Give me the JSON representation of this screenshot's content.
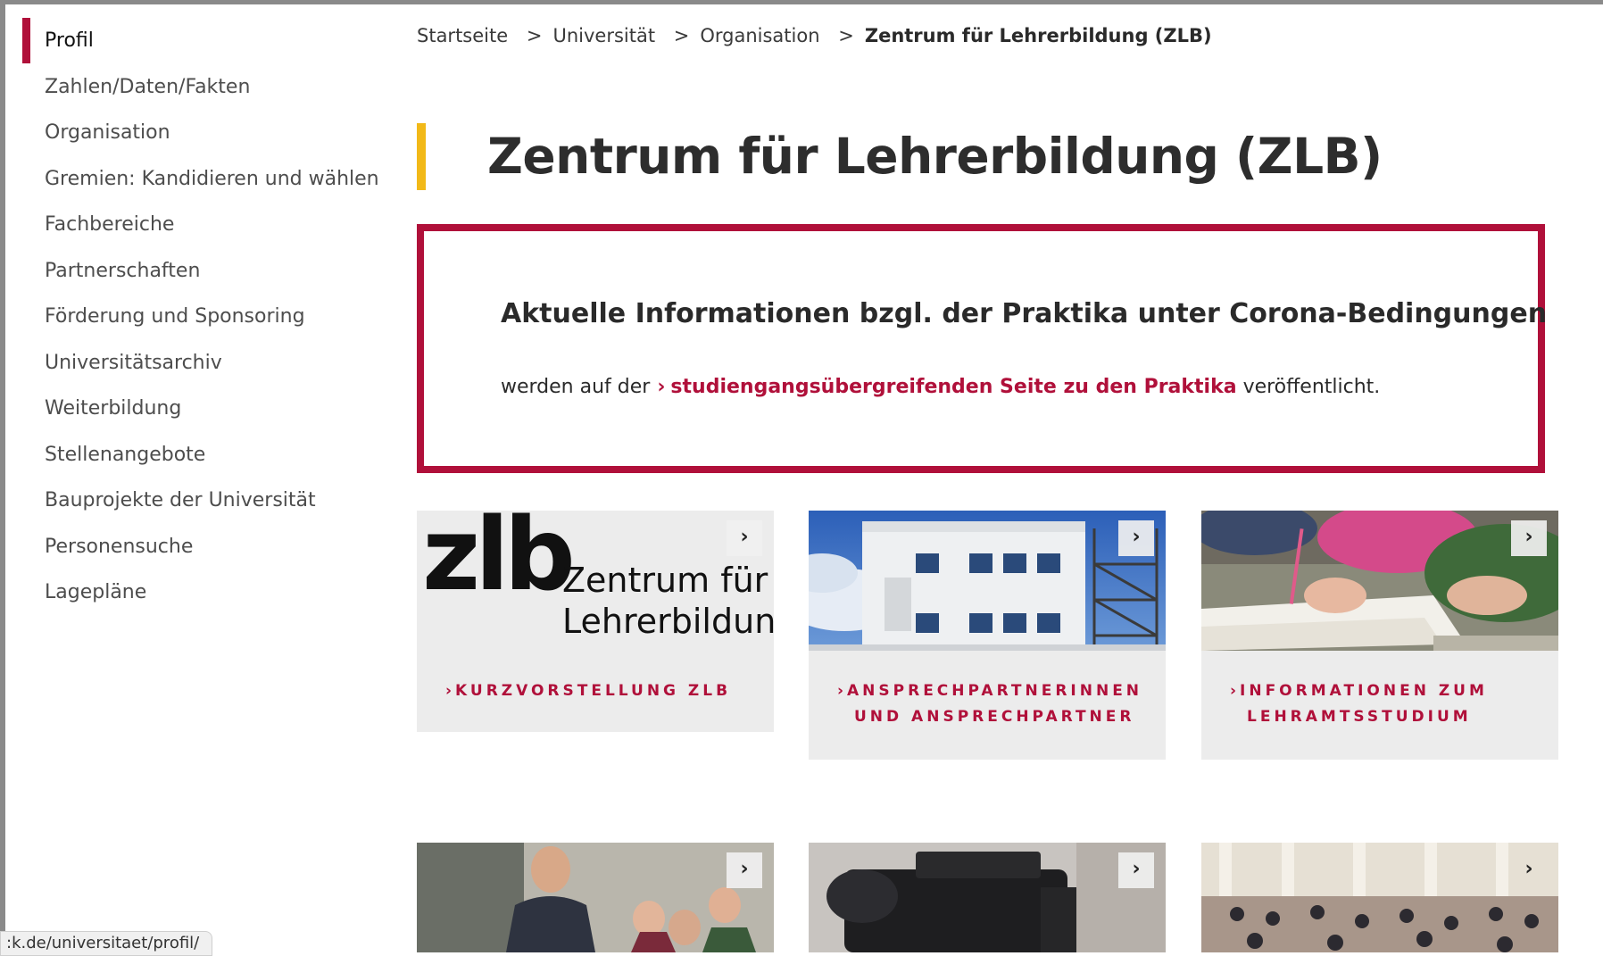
{
  "colors": {
    "accent": "#b0103a",
    "title_bar": "#f2b918"
  },
  "sidebar": {
    "items": [
      {
        "label": "Profil",
        "active": true
      },
      {
        "label": "Zahlen/Daten/Fakten"
      },
      {
        "label": "Organisation"
      },
      {
        "label": "Gremien: Kandidieren und wählen"
      },
      {
        "label": "Fachbereiche"
      },
      {
        "label": "Partnerschaften"
      },
      {
        "label": "Förderung und Sponsoring"
      },
      {
        "label": "Universitätsarchiv"
      },
      {
        "label": "Weiterbildung"
      },
      {
        "label": "Stellenangebote"
      },
      {
        "label": "Bauprojekte der Universität"
      },
      {
        "label": "Personensuche"
      },
      {
        "label": "Lagepläne"
      }
    ]
  },
  "breadcrumb": {
    "items": [
      "Startseite",
      "Universität",
      "Organisation",
      "Zentrum für Lehrerbildung (ZLB)"
    ],
    "separator": ">"
  },
  "page": {
    "title": "Zentrum für Lehrerbildung (ZLB)"
  },
  "notice": {
    "heading": "Aktuelle Informationen bzgl. der Praktika unter Corona-Bedingungen",
    "text_before": "werden auf der",
    "link_text": "studiengangsübergreifenden Seite zu den Praktika",
    "text_after": "veröffentlicht."
  },
  "cards": [
    {
      "logo_mark": "zlb",
      "logo_line1": "Zentrum für",
      "logo_line2": "Lehrerbildung",
      "label": "KURZVORSTELLUNG ZLB"
    },
    {
      "label_line1": "ANSPRECHPARTNERINNEN",
      "label_line2": "UND ANSPRECHPARTNER"
    },
    {
      "label_line1": "INFORMATIONEN ZUM",
      "label_line2": "LEHRAMTSSTUDIUM"
    }
  ],
  "status_url": ":k.de/universitaet/profil/"
}
